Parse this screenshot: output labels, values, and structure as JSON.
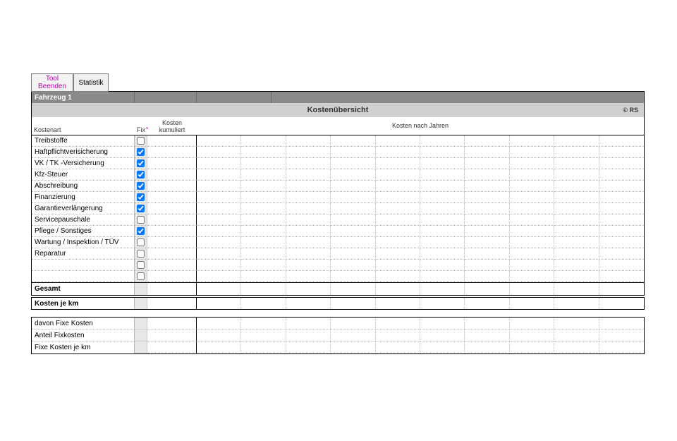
{
  "tabs": {
    "tool": "Tool\nBeenden",
    "stat": "Statistik"
  },
  "vehicle_label": "Fahrzeug 1",
  "title": "Kostenübersicht",
  "copyright": "© RS",
  "headers": {
    "kostenart": "Kostenart",
    "fix": "Fix",
    "kosten": "Kosten",
    "kumuliert": "kumuliert",
    "kosten_nach_jahren": "Kosten nach Jahren"
  },
  "cost_rows": [
    {
      "label": "Treibstoffe",
      "fix": false
    },
    {
      "label": "Haftpflichtverisicherung",
      "fix": true
    },
    {
      "label": "VK / TK -Versicherung",
      "fix": true
    },
    {
      "label": "Kfz-Steuer",
      "fix": true
    },
    {
      "label": "Abschreibung",
      "fix": true
    },
    {
      "label": "Finanzierung",
      "fix": true
    },
    {
      "label": "Garantieverlängerung",
      "fix": true
    },
    {
      "label": "Servicepauschale",
      "fix": false
    },
    {
      "label": "Pflege / Sonstiges",
      "fix": true
    },
    {
      "label": "Wartung / Inspektion / TÜV",
      "fix": false
    },
    {
      "label": "Reparatur",
      "fix": false
    },
    {
      "label": "",
      "fix": false
    },
    {
      "label": "",
      "fix": false
    }
  ],
  "gesamt_label": "Gesamt",
  "kosten_je_km_label": "Kosten je km",
  "summary2": [
    "davon Fixe Kosten",
    "Anteil Fixkosten",
    "Fixe Kosten je km"
  ],
  "year_columns": 10
}
